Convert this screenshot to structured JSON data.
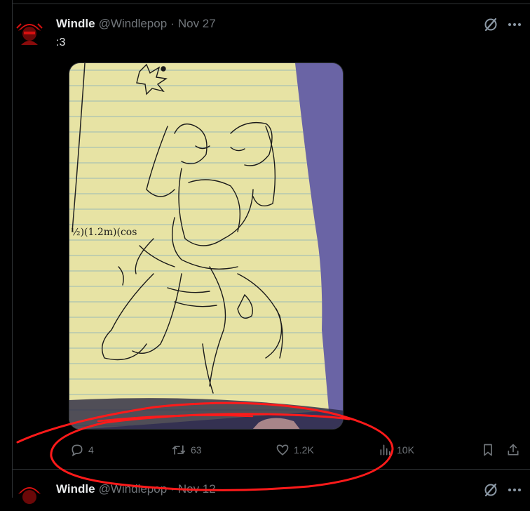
{
  "tweets": [
    {
      "name": "Windle",
      "handle": "@Windlepop",
      "separator": "·",
      "date": "Nov 27",
      "text": ":3",
      "actions": {
        "replies": "4",
        "retweets": "63",
        "likes": "1.2K",
        "views": "10K"
      }
    },
    {
      "name": "Windle",
      "handle": "@Windlepop",
      "separator": "·",
      "date": "Nov 12"
    }
  ],
  "colors": {
    "background": "#000000",
    "secondary_text": "#71767b",
    "annotation": "#ff1a1a",
    "avatar_accent": "#d81010"
  },
  "icons": [
    "grok-icon",
    "more-icon",
    "reply-icon",
    "retweet-icon",
    "like-icon",
    "views-icon",
    "bookmark-icon",
    "share-icon"
  ]
}
